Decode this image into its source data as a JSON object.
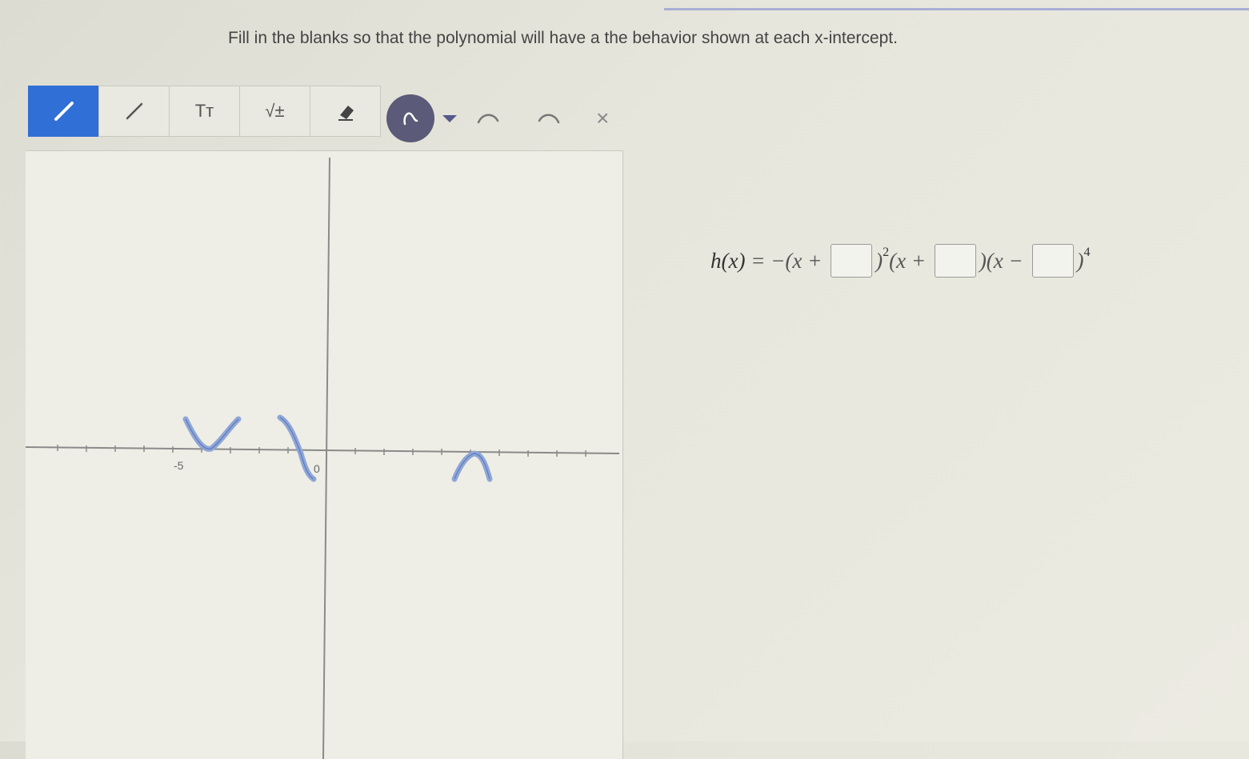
{
  "instructions": "Fill in the blanks so that the polynomial will have a the behavior shown at each x-intercept.",
  "toolbar": {
    "tools": [
      {
        "icon": "pencil-icon",
        "active": true
      },
      {
        "icon": "line-icon",
        "active": false
      },
      {
        "icon": "text-icon",
        "label": "Tт",
        "active": false
      },
      {
        "icon": "math-icon",
        "label": "√±",
        "active": false
      },
      {
        "icon": "eraser-icon",
        "active": false
      }
    ],
    "extras": [
      "lasso-icon",
      "chevron-down-icon",
      "undo-icon",
      "redo-icon",
      "close-icon"
    ],
    "clear_label": "×"
  },
  "graph": {
    "tick_labels": {
      "neg_five": "-5",
      "zero": "0"
    }
  },
  "equation": {
    "lhs": "h(x)",
    "eq": " = −(x + ",
    "exp1": "2",
    "seg2": "(x + ",
    "seg3": ")(x − ",
    "exp3": "4",
    "close1": ")",
    "close3": ")"
  },
  "colors": {
    "accent": "#2f6fd6",
    "ink": "#8fa6d8",
    "lasso": "#5b5a78"
  }
}
